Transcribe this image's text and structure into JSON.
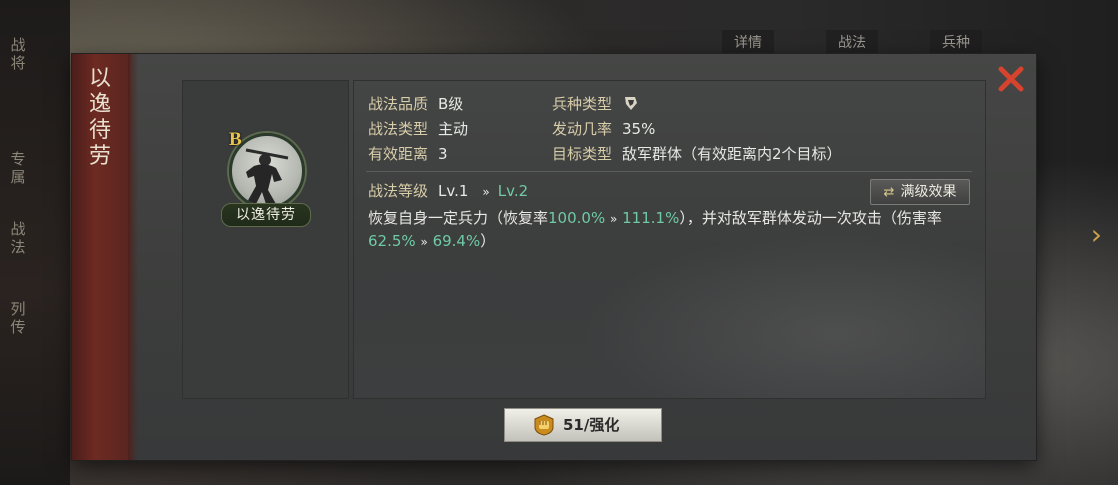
{
  "background": {
    "side_labels": [
      "战将",
      "专属",
      "战法",
      "列传"
    ],
    "tabs": [
      "详情",
      "战法",
      "兵种"
    ],
    "next_arrow": "›"
  },
  "dialog": {
    "title": "以逸待劳",
    "close_icon": "close-x-icon",
    "tactic": {
      "grade": "B",
      "name_plate": "以逸待劳"
    },
    "attributes": {
      "quality_label": "战法品质",
      "quality_value": "B级",
      "troop_label": "兵种类型",
      "troop_icon": "troop-type-icon",
      "type_label": "战法类型",
      "type_value": "主动",
      "rate_label": "发动几率",
      "rate_value": "35%",
      "range_label": "有效距离",
      "range_value": "3",
      "target_label": "目标类型",
      "target_value": "敌军群体（有效距离内2个目标）"
    },
    "level": {
      "label": "战法等级",
      "current": "Lv.1",
      "arrow": "»",
      "next": "Lv.2"
    },
    "max_effect_button": {
      "icon": "⇄",
      "label": "满级效果"
    },
    "description": {
      "p1": "恢复自身一定兵力（恢复率",
      "v1": "100.0%",
      "arrow": "»",
      "v2": "111.1%",
      "p2": "），并对敌军群体发动一次攻击（伤害率",
      "v3": "62.5%",
      "v4": "69.4%",
      "p3": "）"
    },
    "enhance_button": {
      "icon": "fist-coin-icon",
      "label": "51/强化"
    }
  },
  "colors": {
    "accent_green": "#6fcaa6",
    "label_gold": "#d8cda9",
    "close_red": "#d6432e",
    "grade_gold": "#e7c24a"
  }
}
